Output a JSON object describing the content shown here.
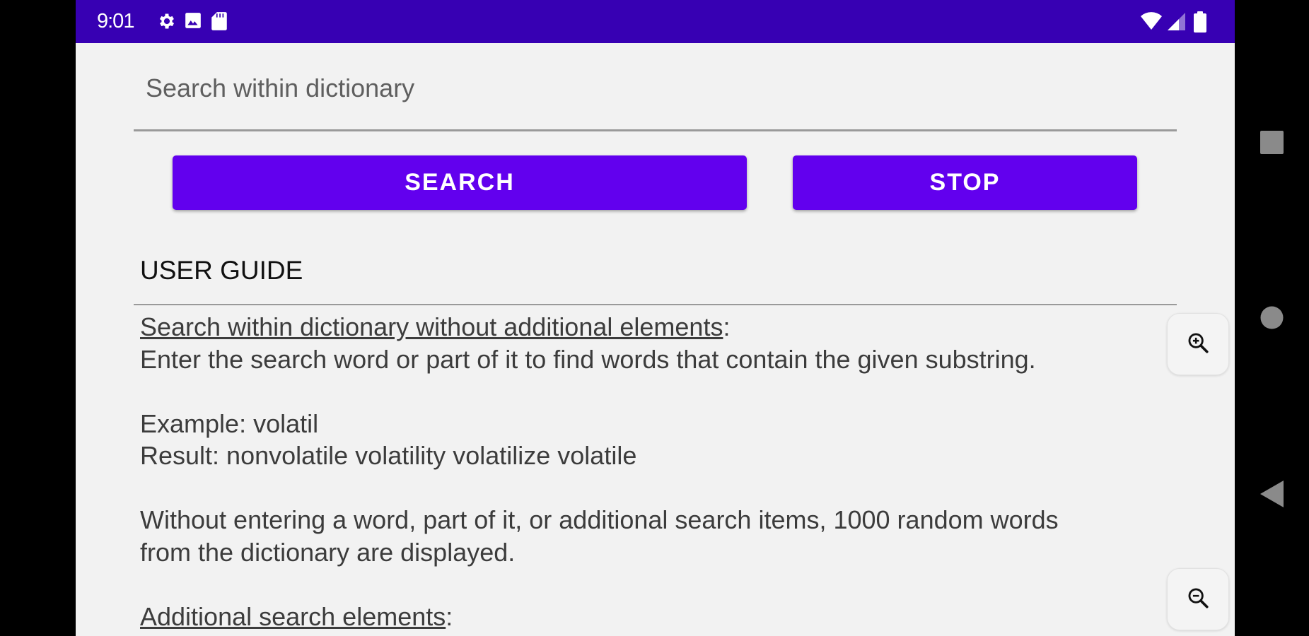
{
  "status_bar": {
    "time": "9:01",
    "icons": [
      "settings-icon",
      "photo-icon",
      "sd-card-icon",
      "wifi-icon",
      "signal-icon",
      "battery-icon"
    ],
    "color": "#3700b3"
  },
  "search": {
    "placeholder": "Search within dictionary",
    "value": ""
  },
  "buttons": {
    "search_label": "SEARCH",
    "stop_label": "STOP",
    "color": "#6200ee"
  },
  "guide": {
    "title": "USER GUIDE",
    "section1_heading": "Search within dictionary without additional elements",
    "section1_heading_suffix": ":",
    "section1_text": "Enter the search word or part of it to find words that contain the given substring.",
    "example": "Example: volatil",
    "result": "Result: nonvolatile volatility volatilize volatile",
    "random_line1": "Without entering a word, part of it, or additional search items, 1000 random words",
    "random_line2": "from the dictionary are displayed.",
    "section2_heading": "Additional search elements",
    "section2_heading_suffix": ":"
  },
  "zoom": {
    "in_icon": "zoom-in-icon",
    "out_icon": "zoom-out-icon"
  },
  "navigation": {
    "icons": [
      "recents-icon",
      "home-icon",
      "back-icon"
    ]
  }
}
